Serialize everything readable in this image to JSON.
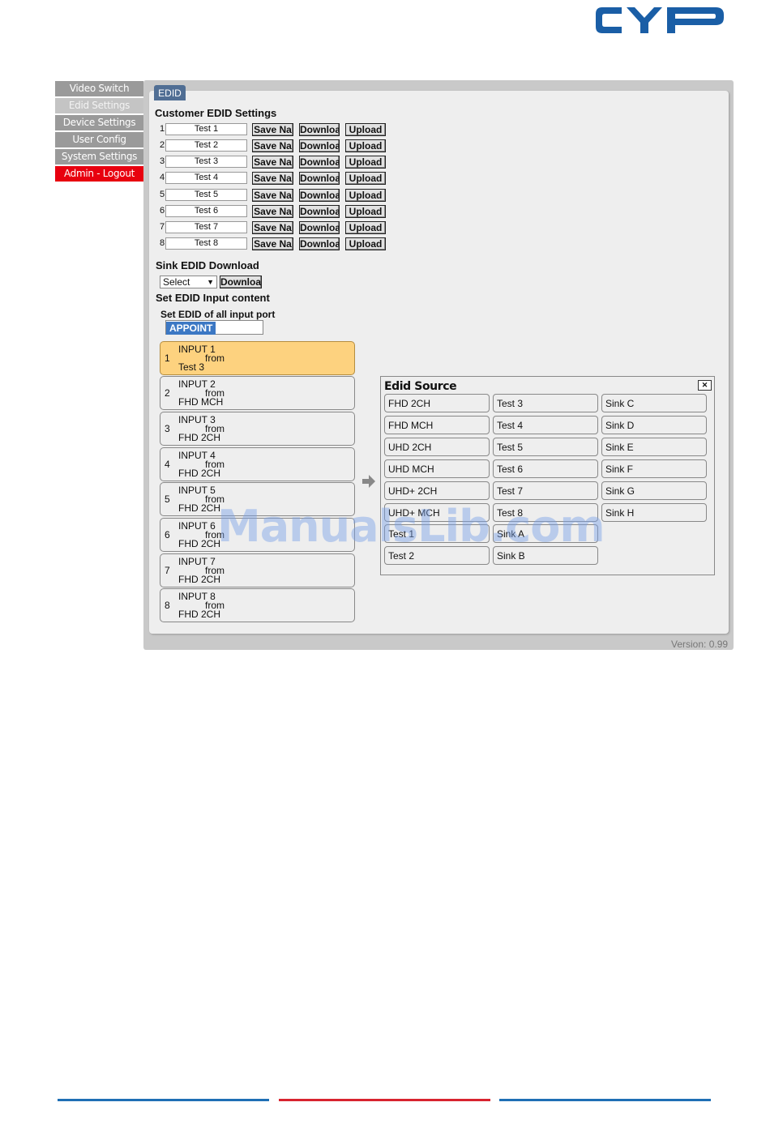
{
  "brand": {
    "logo_text": "CYP",
    "logo_color": "#1a5ea6"
  },
  "nav": {
    "items": [
      {
        "label": "Video Switch"
      },
      {
        "label": "Edid Settings"
      },
      {
        "label": "Device Settings"
      },
      {
        "label": "User Config"
      },
      {
        "label": "System Settings"
      },
      {
        "label": "Admin - Logout"
      }
    ]
  },
  "tab": {
    "label": "EDID"
  },
  "customer": {
    "title": "Customer EDID Settings",
    "save_label": "Save Na",
    "download_label": "Downloa",
    "upload_label": "Upload",
    "rows": [
      {
        "num": "1",
        "name": "Test 1"
      },
      {
        "num": "2",
        "name": "Test 2"
      },
      {
        "num": "3",
        "name": "Test 3"
      },
      {
        "num": "4",
        "name": "Test 4"
      },
      {
        "num": "5",
        "name": "Test 5"
      },
      {
        "num": "6",
        "name": "Test 6"
      },
      {
        "num": "7",
        "name": "Test 7"
      },
      {
        "num": "8",
        "name": "Test 8"
      }
    ]
  },
  "sink": {
    "title": "Sink EDID Download",
    "select_value": "Select",
    "download_label": "Downloa"
  },
  "set_input": {
    "title": "Set EDID Input content",
    "all_label": "Set EDID of all input port",
    "appoint_label": "APPOINT"
  },
  "inputs": [
    {
      "num": "1",
      "label": "INPUT 1",
      "from": "from",
      "source": "Test 3",
      "selected": true
    },
    {
      "num": "2",
      "label": "INPUT 2",
      "from": "from",
      "source": "FHD MCH"
    },
    {
      "num": "3",
      "label": "INPUT 3",
      "from": "from",
      "source": "FHD 2CH"
    },
    {
      "num": "4",
      "label": "INPUT 4",
      "from": "from",
      "source": "FHD 2CH"
    },
    {
      "num": "5",
      "label": "INPUT 5",
      "from": "from",
      "source": "FHD 2CH"
    },
    {
      "num": "6",
      "label": "INPUT 6",
      "from": "from",
      "source": "FHD 2CH"
    },
    {
      "num": "7",
      "label": "INPUT 7",
      "from": "from",
      "source": "FHD 2CH"
    },
    {
      "num": "8",
      "label": "INPUT 8",
      "from": "from",
      "source": "FHD 2CH"
    }
  ],
  "edid_source": {
    "title": "Edid Source",
    "col1": [
      "FHD 2CH",
      "FHD MCH",
      "UHD 2CH",
      "UHD MCH",
      "UHD+ 2CH",
      "UHD+ MCH",
      "Test 1",
      "Test 2"
    ],
    "col2": [
      "Test 3",
      "Test 4",
      "Test 5",
      "Test 6",
      "Test 7",
      "Test 8",
      "Sink A",
      "Sink B"
    ],
    "col3": [
      "Sink C",
      "Sink D",
      "Sink E",
      "Sink F",
      "Sink G",
      "Sink H"
    ]
  },
  "version": "Version: 0.99",
  "watermark": "ManualsLib.com",
  "footer_colors": [
    "#1f6fb5",
    "#d8242f",
    "#1f6fb5"
  ],
  "colors": {
    "selected_input": "#fdd27f",
    "tab": "#506e94",
    "logout": "#e8000f"
  }
}
